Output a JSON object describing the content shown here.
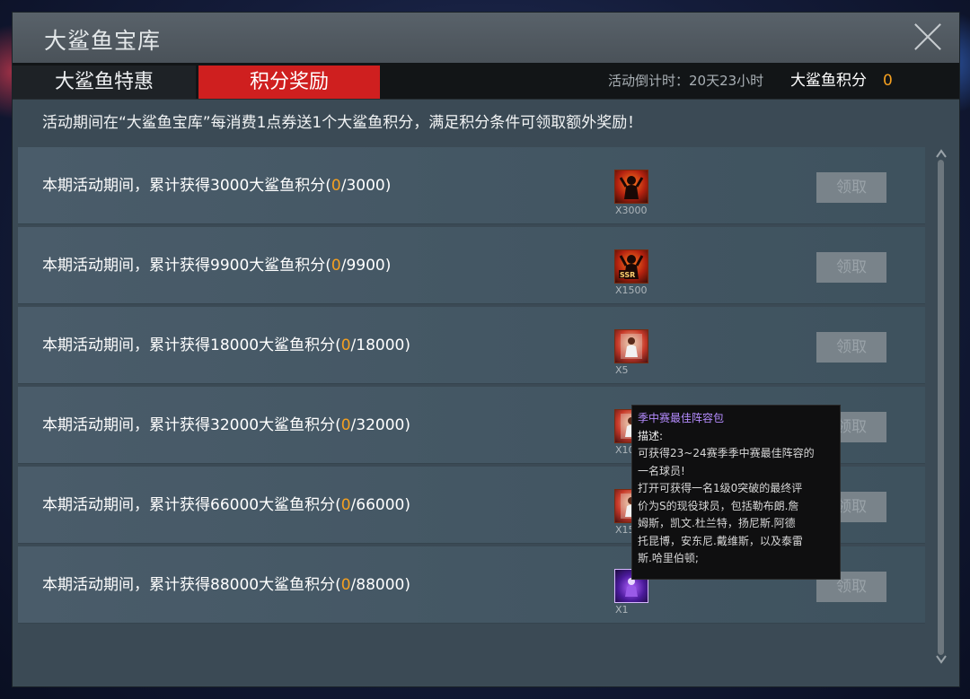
{
  "window": {
    "title": "大鲨鱼宝库"
  },
  "tabs": [
    {
      "label": "大鲨鱼特惠",
      "active": false
    },
    {
      "label": "积分奖励",
      "active": true
    }
  ],
  "header": {
    "countdown": "活动倒计时：20天23小时",
    "points_label": "大鲨鱼积分",
    "points_value": "0"
  },
  "notice": "活动期间在“大鲨鱼宝库”每消费1点券送1个大鲨鱼积分，满足积分条件可领取额外奖励！",
  "colors": {
    "accent_red": "#cf1f1f",
    "progress_orange": "#f5a020",
    "tooltip_title": "#b58cff"
  },
  "rows": [
    {
      "prefix": "本期活动期间，累计获得3000大鲨鱼积分(",
      "current": "0",
      "suffix": "/3000)",
      "reward_icon": "fire-player-icon",
      "reward_qty": "X3000",
      "claim_label": "领取"
    },
    {
      "prefix": "本期活动期间，累计获得9900大鲨鱼积分(",
      "current": "0",
      "suffix": "/9900)",
      "reward_icon": "ssr-fire-player-icon",
      "reward_qty": "X1500",
      "claim_label": "领取"
    },
    {
      "prefix": "本期活动期间，累计获得18000大鲨鱼积分(",
      "current": "0",
      "suffix": "/18000)",
      "reward_icon": "player-card-pack-icon",
      "reward_qty": "X5",
      "claim_label": "领取"
    },
    {
      "prefix": "本期活动期间，累计获得32000大鲨鱼积分(",
      "current": "0",
      "suffix": "/32000)",
      "reward_icon": "player-card-pack-icon",
      "reward_qty": "X10",
      "claim_label": "领取"
    },
    {
      "prefix": "本期活动期间，累计获得66000大鲨鱼积分(",
      "current": "0",
      "suffix": "/66000)",
      "reward_icon": "player-card-pack-icon",
      "reward_qty": "X15",
      "claim_label": "领取"
    },
    {
      "prefix": "本期活动期间，累计获得88000大鲨鱼积分(",
      "current": "0",
      "suffix": "/88000)",
      "reward_icon": "purple-player-card-icon",
      "reward_qty": "X1",
      "claim_label": "领取"
    }
  ],
  "tooltip": {
    "title": "季中赛最佳阵容包",
    "desc_label": "描述:",
    "lines": [
      "可获得23~24赛季季中赛最佳阵容的",
      "一名球员!",
      "打开可获得一名1级0突破的最终评",
      "价为S的现役球员，包括勒布朗.詹",
      "姆斯，凯文.杜兰特，扬尼斯.阿德",
      "托昆博，安东尼.戴维斯，以及泰雷",
      "斯.哈里伯顿;"
    ]
  }
}
